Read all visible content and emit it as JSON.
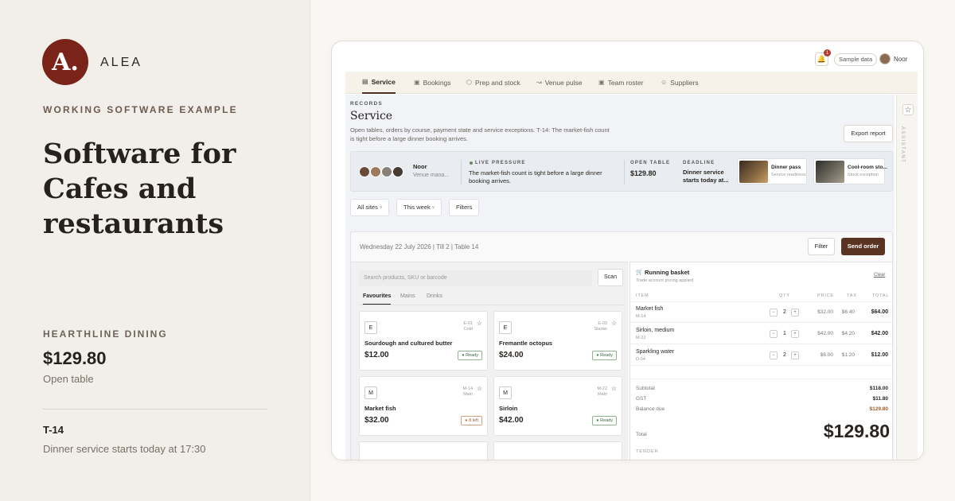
{
  "left": {
    "logo_letter": "A.",
    "brand": "ALEA",
    "eyebrow": "WORKING SOFTWARE EXAMPLE",
    "headline": "Software for Cafes and restaurants",
    "venue": "HEARTHLINE DINING",
    "amount": "$129.80",
    "amount_label": "Open table",
    "table_code": "T-14",
    "service_line": "Dinner service starts today at 17:30"
  },
  "topbar": {
    "bell_count": "1",
    "sample_label": "Sample data",
    "user_name": "Noor"
  },
  "tabs": [
    {
      "label": "Service",
      "icon": "storefront-icon",
      "active": true
    },
    {
      "label": "Bookings",
      "icon": "calendar-icon"
    },
    {
      "label": "Prep and stock",
      "icon": "box-icon"
    },
    {
      "label": "Venue pulse",
      "icon": "chart-icon"
    },
    {
      "label": "Team roster",
      "icon": "calendar-icon"
    },
    {
      "label": "Suppliers",
      "icon": "people-icon"
    }
  ],
  "page": {
    "eyebrow": "RECORDS",
    "title": "Service",
    "description": "Open tables, orders by course, payment state and service exceptions. T-14: The market-fish count is tight before a large dinner booking arrives.",
    "export_label": "Export report"
  },
  "rail": {
    "label": "ASSISTANT"
  },
  "pressure": {
    "person_name": "Noor",
    "person_role": "Venue mana...",
    "live_label": "LIVE PRESSURE",
    "live_text": "The market-fish count is tight before a large dinner booking arrives.",
    "open_table_label": "OPEN TABLE",
    "open_table_value": "$129.80",
    "deadline_label": "DEADLINE",
    "deadline_value": "Dinner service starts today at...",
    "thumbs": [
      {
        "title": "Dinner pass",
        "sub": "Service readiness"
      },
      {
        "title": "Cool-room sto...",
        "sub": "Stock exception"
      }
    ]
  },
  "filters": {
    "site": "All sites",
    "period": "This week",
    "filters": "Filters"
  },
  "pos": {
    "date_line": "Wednesday 22 July 2026 | Till 2 | Table 14",
    "filter_label": "Filter",
    "send_label": "Send order",
    "search_placeholder": "Search products, SKU or barcode",
    "scan_label": "Scan",
    "subtabs": [
      "Favourites",
      "Mains",
      "Drinks"
    ],
    "products": [
      {
        "letter": "E",
        "code": "E-01",
        "cat": "Cold",
        "name": "Sourdough and cultured butter",
        "price": "$12.00",
        "badge": "Ready"
      },
      {
        "letter": "E",
        "code": "E-03",
        "cat": "Starter",
        "name": "Fremantle octopus",
        "price": "$24.00",
        "badge": "Ready"
      },
      {
        "letter": "M",
        "code": "M-14",
        "cat": "Main",
        "name": "Market fish",
        "price": "$32.00",
        "badge": "8 left"
      },
      {
        "letter": "M",
        "code": "M-22",
        "cat": "Main",
        "name": "Sirloin",
        "price": "$42.00",
        "badge": "Ready"
      }
    ],
    "basket": {
      "title": "Running basket",
      "subtitle": "Trade account pricing applied",
      "clear": "Clear",
      "headers": [
        "ITEM",
        "QTY",
        "PRICE",
        "TAX",
        "TOTAL"
      ],
      "rows": [
        {
          "item": "Market fish",
          "code": "M-14",
          "qty": "2",
          "price": "$32.00",
          "tax": "$6.40",
          "total": "$64.00"
        },
        {
          "item": "Sirloin, medium",
          "code": "M-22",
          "qty": "1",
          "price": "$42.00",
          "tax": "$4.20",
          "total": "$42.00"
        },
        {
          "item": "Sparkling water",
          "code": "D-04",
          "qty": "2",
          "price": "$6.00",
          "tax": "$1.20",
          "total": "$12.00"
        }
      ],
      "subtotal_label": "Subtotal",
      "subtotal": "$118.00",
      "gst_label": "GST",
      "gst": "$11.80",
      "balance_label": "Balance due",
      "balance": "$129.80",
      "total_label": "Total",
      "total": "$129.80",
      "tender_label": "TENDER"
    }
  },
  "colors": {
    "brand": "#7a2419",
    "primary_button": "#5a3322",
    "ready": "#3c6b3c",
    "warning": "#a45a2a"
  }
}
